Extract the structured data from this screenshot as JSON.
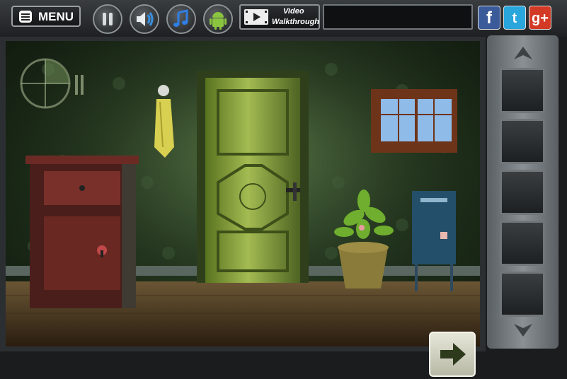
{
  "toolbar": {
    "menu_label": "MENU",
    "video_label_line1": "Video",
    "video_label_line2": "Walkthrough"
  },
  "social": {
    "facebook": "f",
    "twitter": "t",
    "googleplus": "g+"
  },
  "colors": {
    "wall": "#2f4a2c",
    "door": "#7d9a3e",
    "floor": "#5a4328",
    "facebook": "#3b5a9a",
    "twitter": "#29a6dc",
    "googleplus": "#d23a25"
  },
  "inventory": {
    "slots": 5
  }
}
